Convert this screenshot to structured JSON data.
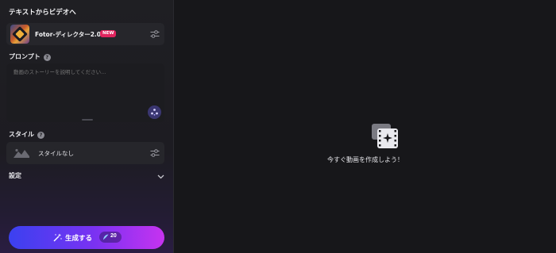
{
  "sidebar": {
    "title": "テキストからビデオへ",
    "model": {
      "name": "Fotor-ディレクター2.0",
      "badge": "NEW",
      "settings_icon": "sliders-icon"
    },
    "prompt": {
      "label": "プロンプト",
      "help_icon": "question-icon",
      "placeholder": "動画のストーリーを説明してください...",
      "magic_icon": "sparkle-dots-icon"
    },
    "style": {
      "label": "スタイル",
      "help_icon": "question-icon",
      "value": "スタイルなし",
      "thumb_icon": "landscape-icon",
      "settings_icon": "sliders-icon"
    },
    "settings": {
      "label": "設定",
      "chevron_icon": "chevron-down-icon"
    },
    "generate": {
      "label": "生成する",
      "credits": "20",
      "icon": "magic-wand-icon",
      "credit_icon": "feather-icon"
    }
  },
  "main": {
    "empty_icon": "video-sparkle-icon",
    "empty_text": "今すぐ動画を作成しよう！"
  },
  "colors": {
    "background": "#17171a",
    "sidebar": "#1f1f23",
    "card": "#26262b",
    "new_badge": "#e0245e",
    "button_gradient_start": "#3b41f0",
    "button_gradient_end": "#c633f0"
  }
}
